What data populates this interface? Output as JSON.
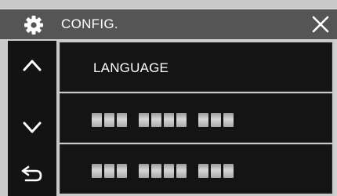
{
  "header": {
    "title": "CONFIG.",
    "icon_left": "gear-icon",
    "icon_right": "close-icon"
  },
  "sidebar": {
    "buttons": [
      {
        "icon": "chevron-up-icon"
      },
      {
        "icon": "chevron-down-icon"
      },
      {
        "icon": "return-arrow-icon"
      }
    ]
  },
  "menu": {
    "items": [
      {
        "label": "LANGUAGE"
      }
    ]
  },
  "colors": {
    "title_bar": "#555555",
    "panel": "#141414",
    "frame": "#c9c9c9",
    "text": "#ffffff"
  }
}
